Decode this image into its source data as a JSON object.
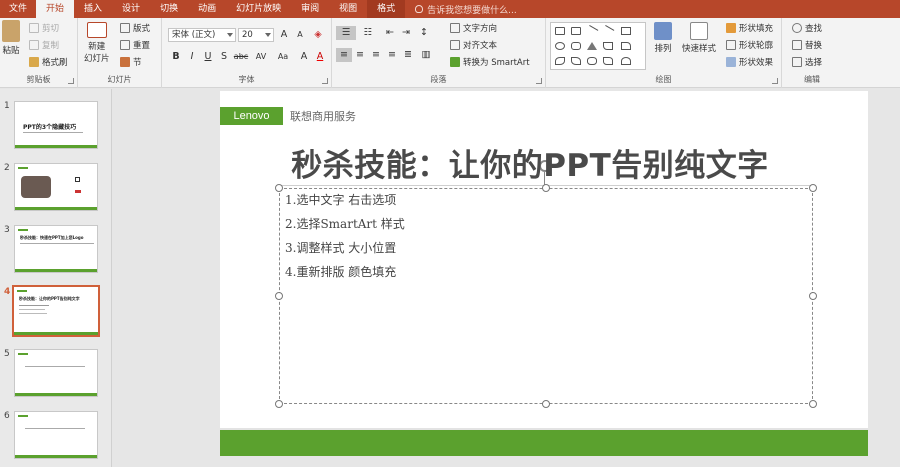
{
  "menu": {
    "tabs": [
      "文件",
      "开始",
      "插入",
      "设计",
      "切换",
      "动画",
      "幻灯片放映",
      "审阅",
      "视图",
      "格式"
    ],
    "active_tab": "开始",
    "tell_me": "告诉我您想要做什么..."
  },
  "ribbon": {
    "clipboard": {
      "label": "剪贴板",
      "paste": "粘贴",
      "cut": "剪切",
      "copy": "复制",
      "format_painter": "格式刷"
    },
    "slides": {
      "label": "幻灯片",
      "new_slide": "新建",
      "new_slide_2": "幻灯片",
      "layout": "版式",
      "reset": "重置",
      "section": "节"
    },
    "font": {
      "label": "字体",
      "font_name": "宋体 (正文)",
      "font_size": "20",
      "bold": "B",
      "italic": "I",
      "underline": "U",
      "shadow": "S",
      "strike": "abc",
      "spacing": "AV",
      "case": "Aa",
      "clear": "A",
      "color": "A"
    },
    "paragraph": {
      "label": "段落",
      "text_direction": "文字方向",
      "align_text": "对齐文本",
      "smartart": "转换为 SmartArt"
    },
    "drawing": {
      "label": "绘图",
      "arrange": "排列",
      "quick_styles": "快速样式",
      "fill": "形状填充",
      "outline": "形状轮廓",
      "effects": "形状效果"
    },
    "editing": {
      "label": "编辑",
      "find": "查找",
      "replace": "替换",
      "select": "选择"
    }
  },
  "slide_pane": {
    "slides": [
      {
        "num": "1",
        "title": "PPT的3个隐藏技巧"
      },
      {
        "num": "2",
        "title": ""
      },
      {
        "num": "3",
        "title": "秒杀技能：快速在PPT加上您Logo"
      },
      {
        "num": "4",
        "title": "秒杀技能：让你的PPT告别纯文字"
      },
      {
        "num": "5",
        "title": ""
      },
      {
        "num": "6",
        "title": ""
      }
    ],
    "selected": "4"
  },
  "slide": {
    "logo": "Lenovo",
    "service": "联想商用服务",
    "title": "秒杀技能：让你的PPT告别纯文字",
    "bullets": [
      "1.选中文字 右击选项",
      "2.选择SmartArt 样式",
      "3.调整样式 大小位置",
      "4.重新排版 颜色填充"
    ]
  },
  "colors": {
    "accent": "#b7472a",
    "brand_green": "#5ba12e",
    "selected_thumb": "#d0603a"
  }
}
